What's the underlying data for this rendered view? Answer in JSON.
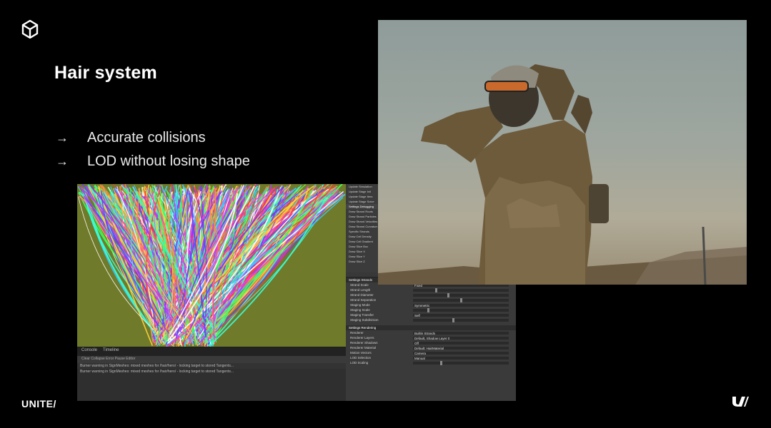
{
  "slide": {
    "title": "Hair system",
    "bullets": [
      {
        "arrow": "→",
        "text": "Accurate collisions"
      },
      {
        "arrow": "→",
        "text": "LOD without losing shape"
      }
    ],
    "wordmark": "UNITE/"
  },
  "editor": {
    "console": {
      "tabs": [
        "Console",
        "Timeline"
      ],
      "toolbar": "Clear  Collapse  Error Pause  Editor",
      "lines": [
        "Burner warning in SignMeshes: mixed meshes for /hair/hero/ - locking target to stored Tangents...",
        "Burner warning in SignMeshes: mixed meshes for /hair/hero/ - locking target to stored Tangents..."
      ]
    },
    "inspector_list": [
      {
        "label": "Update Simulation",
        "header": false
      },
      {
        "label": "Update Stage Init",
        "header": false
      },
      {
        "label": "Update Stage Iters",
        "header": false
      },
      {
        "label": "Update Stage Solve",
        "header": false
      },
      {
        "label": "Settings Debugging",
        "header": true
      },
      {
        "label": "Draw Strand Roots",
        "header": false
      },
      {
        "label": "Draw Strand Particles",
        "header": false
      },
      {
        "label": "Draw Strand Velocities",
        "header": false
      },
      {
        "label": "Draw Strand Curvature",
        "header": false
      },
      {
        "label": "Specific Strands",
        "header": false
      },
      {
        "label": "Draw Cell Density",
        "header": false
      },
      {
        "label": "Draw Cell Gradient",
        "header": false
      },
      {
        "label": "Draw Slice Box",
        "header": false
      },
      {
        "label": "Draw Slice X",
        "header": false
      },
      {
        "label": "Draw Slice Y",
        "header": false
      },
      {
        "label": "Draw Slice Z",
        "header": false
      }
    ],
    "inspector_panel": {
      "header": "Settings Strands",
      "rows": [
        {
          "label": "Strand Scale",
          "value": "Fixed"
        },
        {
          "label": "Strand Length",
          "value": ""
        },
        {
          "label": "Strand Diameter",
          "value": ""
        },
        {
          "label": "Strand Separation",
          "value": ""
        },
        {
          "label": "Staging Mode",
          "value": "Symmetric"
        },
        {
          "label": "Staging Scale",
          "value": ""
        },
        {
          "label": "Staging Transfer",
          "value": "Self"
        },
        {
          "label": "Staging Subdivision",
          "value": ""
        }
      ],
      "section2": "Settings Rendering",
      "rows2": [
        {
          "label": "Renderer",
          "value": "Builtin Strands"
        },
        {
          "label": "Renderer Layers",
          "value": "Default, Shadow Layer 0"
        },
        {
          "label": "Renderer Shadows",
          "value": "Off"
        },
        {
          "label": "Renderer Material",
          "value": "Default: HairMaterial"
        },
        {
          "label": "Motion Vectors",
          "value": "Camera"
        },
        {
          "label": "LOD Selection",
          "value": "Manual"
        },
        {
          "label": "LOD Scaling",
          "value": ""
        }
      ]
    }
  },
  "colors": {
    "background": "#000000",
    "scene_ground": "#6f7a2a",
    "editor_dark": "#2b2b2b"
  }
}
